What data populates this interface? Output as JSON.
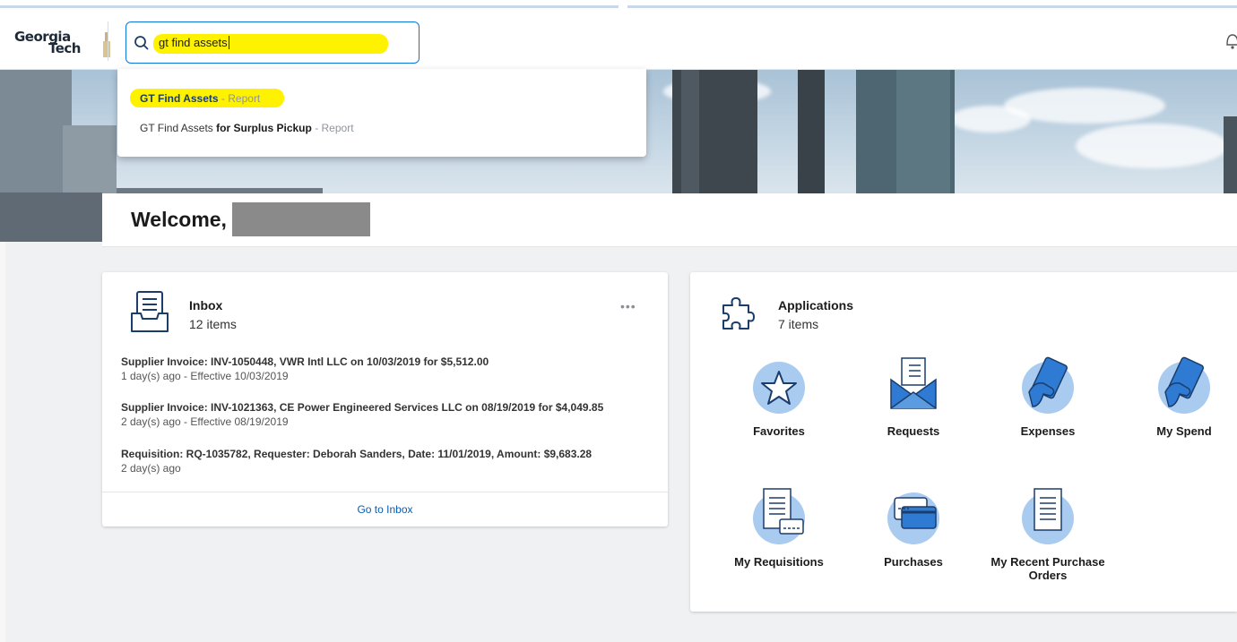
{
  "header": {
    "logo": {
      "line1": "Georgia",
      "line2": "Tech"
    },
    "search": {
      "value": "gt find assets"
    }
  },
  "search_results": [
    {
      "name": "GT Find Assets",
      "kind": "- Report"
    },
    {
      "name_plain": "GT Find Assets ",
      "name_bold": "for Surplus Pickup",
      "kind": "- Report"
    }
  ],
  "welcome": {
    "text": "Welcome,"
  },
  "inbox": {
    "title": "Inbox",
    "count": "12 items",
    "more": "•••",
    "items": [
      {
        "title": "Supplier Invoice: INV-1050448, VWR Intl LLC on 10/03/2019 for $5,512.00",
        "meta": "1 day(s) ago - Effective 10/03/2019"
      },
      {
        "title": "Supplier Invoice: INV-1021363, CE Power Engineered Services LLC on 08/19/2019 for $4,049.85",
        "meta": "2 day(s) ago - Effective 08/19/2019"
      },
      {
        "title": "Requisition: RQ-1035782, Requester: Deborah Sanders, Date: 11/01/2019, Amount: $9,683.28",
        "meta": "2 day(s) ago"
      }
    ],
    "link": "Go to Inbox"
  },
  "applications": {
    "title": "Applications",
    "count": "7 items",
    "tiles": [
      {
        "label": "Favorites",
        "icon": "star-icon"
      },
      {
        "label": "Requests",
        "icon": "envelope-list-icon"
      },
      {
        "label": "Expenses",
        "icon": "hand-card-icon"
      },
      {
        "label": "My Spend",
        "icon": "hand-card-icon"
      },
      {
        "label": "My Requisitions",
        "icon": "document-card-icon"
      },
      {
        "label": "Purchases",
        "icon": "credit-card-icon"
      },
      {
        "label": "My Recent Purchase Orders",
        "icon": "document-list-icon"
      }
    ]
  },
  "colors": {
    "accent": "#0875e1",
    "highlight": "#fff200",
    "tile_circle": "#a9cbf0",
    "link": "#0b5cad"
  }
}
